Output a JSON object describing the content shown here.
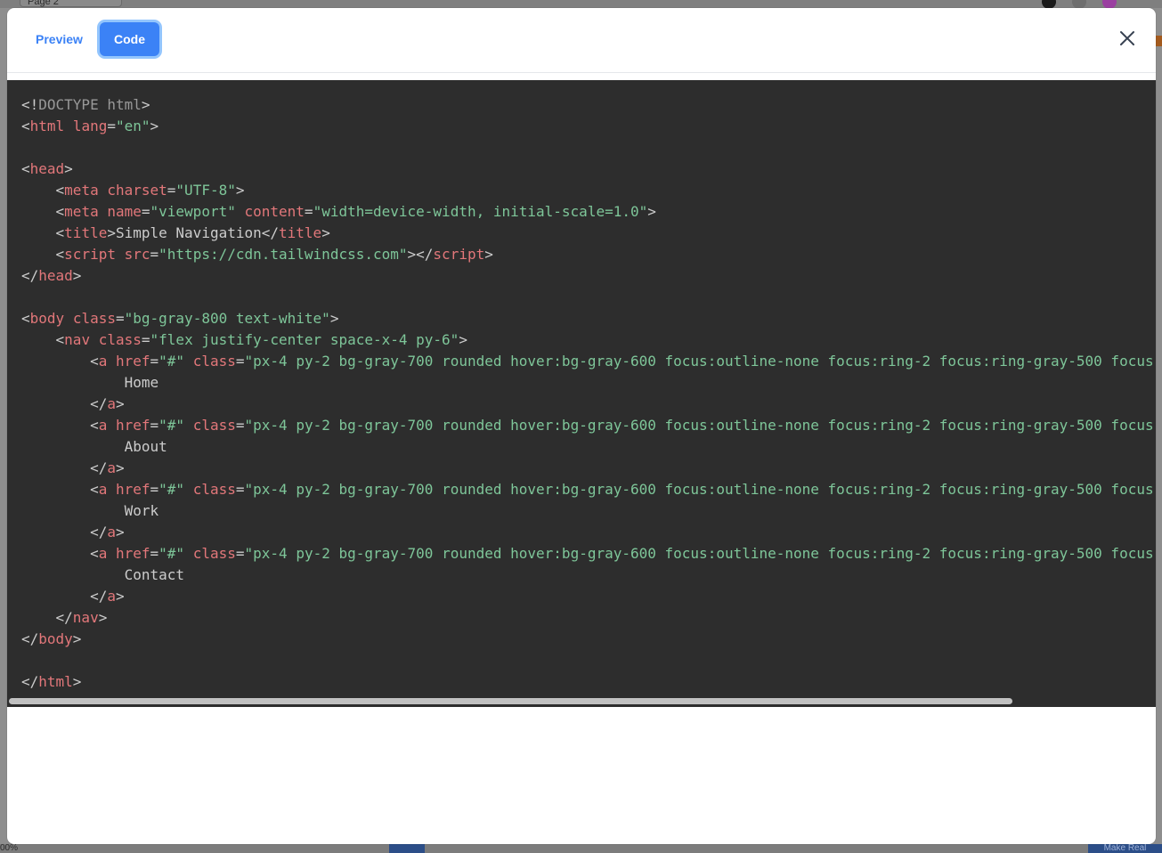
{
  "background": {
    "page_select_label": "Page 2",
    "zoom_label": "00%",
    "bottom_button_label": "Make Real",
    "colors": [
      "#1a1a1a",
      "#6e6e6e",
      "#9a3fa0"
    ]
  },
  "modal": {
    "tabs": [
      {
        "label": "Preview",
        "active": false
      },
      {
        "label": "Code",
        "active": true
      }
    ],
    "close_icon": "close-icon"
  },
  "code": {
    "lines": [
      [
        [
          "punct",
          "<!"
        ],
        [
          "doctype",
          "DOCTYPE html"
        ],
        [
          "punct",
          ">"
        ]
      ],
      [
        [
          "punct",
          "<"
        ],
        [
          "tag",
          "html"
        ],
        [
          "text",
          " "
        ],
        [
          "attr",
          "lang"
        ],
        [
          "punct",
          "="
        ],
        [
          "str",
          "\"en\""
        ],
        [
          "punct",
          ">"
        ]
      ],
      [],
      [
        [
          "punct",
          "<"
        ],
        [
          "tag",
          "head"
        ],
        [
          "punct",
          ">"
        ]
      ],
      [
        [
          "text",
          "    "
        ],
        [
          "punct",
          "<"
        ],
        [
          "tag",
          "meta"
        ],
        [
          "text",
          " "
        ],
        [
          "attr",
          "charset"
        ],
        [
          "punct",
          "="
        ],
        [
          "str",
          "\"UTF-8\""
        ],
        [
          "punct",
          ">"
        ]
      ],
      [
        [
          "text",
          "    "
        ],
        [
          "punct",
          "<"
        ],
        [
          "tag",
          "meta"
        ],
        [
          "text",
          " "
        ],
        [
          "attr",
          "name"
        ],
        [
          "punct",
          "="
        ],
        [
          "str",
          "\"viewport\""
        ],
        [
          "text",
          " "
        ],
        [
          "attr",
          "content"
        ],
        [
          "punct",
          "="
        ],
        [
          "str",
          "\"width=device-width, initial-scale=1.0\""
        ],
        [
          "punct",
          ">"
        ]
      ],
      [
        [
          "text",
          "    "
        ],
        [
          "punct",
          "<"
        ],
        [
          "tag",
          "title"
        ],
        [
          "punct",
          ">"
        ],
        [
          "text",
          "Simple Navigation"
        ],
        [
          "punct",
          "</"
        ],
        [
          "tag",
          "title"
        ],
        [
          "punct",
          ">"
        ]
      ],
      [
        [
          "text",
          "    "
        ],
        [
          "punct",
          "<"
        ],
        [
          "tag",
          "script"
        ],
        [
          "text",
          " "
        ],
        [
          "attr",
          "src"
        ],
        [
          "punct",
          "="
        ],
        [
          "str",
          "\"https://cdn.tailwindcss.com\""
        ],
        [
          "punct",
          "></"
        ],
        [
          "tag",
          "script"
        ],
        [
          "punct",
          ">"
        ]
      ],
      [
        [
          "punct",
          "</"
        ],
        [
          "tag",
          "head"
        ],
        [
          "punct",
          ">"
        ]
      ],
      [],
      [
        [
          "punct",
          "<"
        ],
        [
          "tag",
          "body"
        ],
        [
          "text",
          " "
        ],
        [
          "attr",
          "class"
        ],
        [
          "punct",
          "="
        ],
        [
          "str",
          "\"bg-gray-800 text-white\""
        ],
        [
          "punct",
          ">"
        ]
      ],
      [
        [
          "text",
          "    "
        ],
        [
          "punct",
          "<"
        ],
        [
          "tag",
          "nav"
        ],
        [
          "text",
          " "
        ],
        [
          "attr",
          "class"
        ],
        [
          "punct",
          "="
        ],
        [
          "str",
          "\"flex justify-center space-x-4 py-6\""
        ],
        [
          "punct",
          ">"
        ]
      ],
      [
        [
          "text",
          "        "
        ],
        [
          "punct",
          "<"
        ],
        [
          "tag",
          "a"
        ],
        [
          "text",
          " "
        ],
        [
          "attr",
          "href"
        ],
        [
          "punct",
          "="
        ],
        [
          "str",
          "\"#\""
        ],
        [
          "text",
          " "
        ],
        [
          "attr",
          "class"
        ],
        [
          "punct",
          "="
        ],
        [
          "str",
          "\"px-4 py-2 bg-gray-700 rounded hover:bg-gray-600 focus:outline-none focus:ring-2 focus:ring-gray-500 focus:"
        ]
      ],
      [
        [
          "text",
          "            Home"
        ]
      ],
      [
        [
          "text",
          "        "
        ],
        [
          "punct",
          "</"
        ],
        [
          "tag",
          "a"
        ],
        [
          "punct",
          ">"
        ]
      ],
      [
        [
          "text",
          "        "
        ],
        [
          "punct",
          "<"
        ],
        [
          "tag",
          "a"
        ],
        [
          "text",
          " "
        ],
        [
          "attr",
          "href"
        ],
        [
          "punct",
          "="
        ],
        [
          "str",
          "\"#\""
        ],
        [
          "text",
          " "
        ],
        [
          "attr",
          "class"
        ],
        [
          "punct",
          "="
        ],
        [
          "str",
          "\"px-4 py-2 bg-gray-700 rounded hover:bg-gray-600 focus:outline-none focus:ring-2 focus:ring-gray-500 focus:"
        ]
      ],
      [
        [
          "text",
          "            About"
        ]
      ],
      [
        [
          "text",
          "        "
        ],
        [
          "punct",
          "</"
        ],
        [
          "tag",
          "a"
        ],
        [
          "punct",
          ">"
        ]
      ],
      [
        [
          "text",
          "        "
        ],
        [
          "punct",
          "<"
        ],
        [
          "tag",
          "a"
        ],
        [
          "text",
          " "
        ],
        [
          "attr",
          "href"
        ],
        [
          "punct",
          "="
        ],
        [
          "str",
          "\"#\""
        ],
        [
          "text",
          " "
        ],
        [
          "attr",
          "class"
        ],
        [
          "punct",
          "="
        ],
        [
          "str",
          "\"px-4 py-2 bg-gray-700 rounded hover:bg-gray-600 focus:outline-none focus:ring-2 focus:ring-gray-500 focus:"
        ]
      ],
      [
        [
          "text",
          "            Work"
        ]
      ],
      [
        [
          "text",
          "        "
        ],
        [
          "punct",
          "</"
        ],
        [
          "tag",
          "a"
        ],
        [
          "punct",
          ">"
        ]
      ],
      [
        [
          "text",
          "        "
        ],
        [
          "punct",
          "<"
        ],
        [
          "tag",
          "a"
        ],
        [
          "text",
          " "
        ],
        [
          "attr",
          "href"
        ],
        [
          "punct",
          "="
        ],
        [
          "str",
          "\"#\""
        ],
        [
          "text",
          " "
        ],
        [
          "attr",
          "class"
        ],
        [
          "punct",
          "="
        ],
        [
          "str",
          "\"px-4 py-2 bg-gray-700 rounded hover:bg-gray-600 focus:outline-none focus:ring-2 focus:ring-gray-500 focus:"
        ]
      ],
      [
        [
          "text",
          "            Contact"
        ]
      ],
      [
        [
          "text",
          "        "
        ],
        [
          "punct",
          "</"
        ],
        [
          "tag",
          "a"
        ],
        [
          "punct",
          ">"
        ]
      ],
      [
        [
          "text",
          "    "
        ],
        [
          "punct",
          "</"
        ],
        [
          "tag",
          "nav"
        ],
        [
          "punct",
          ">"
        ]
      ],
      [
        [
          "punct",
          "</"
        ],
        [
          "tag",
          "body"
        ],
        [
          "punct",
          ">"
        ]
      ],
      [],
      [
        [
          "punct",
          "</"
        ],
        [
          "tag",
          "html"
        ],
        [
          "punct",
          ">"
        ]
      ]
    ]
  },
  "theme": {
    "accent": "#3b82f6",
    "code_bg": "#2d2d2d",
    "tag_color": "#e2777a",
    "string_color": "#7ec699"
  }
}
